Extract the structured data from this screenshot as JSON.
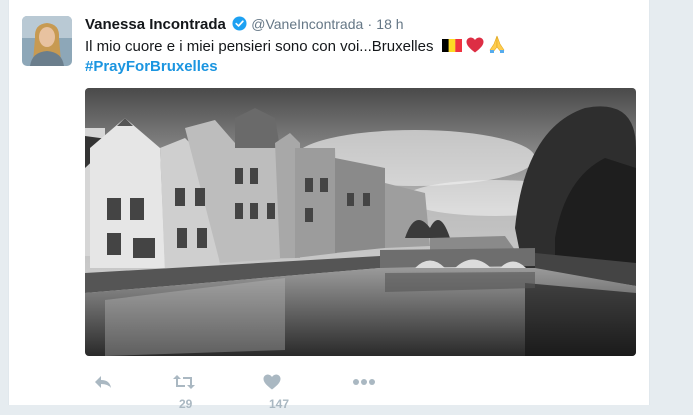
{
  "tweet": {
    "name": "Vanessa Incontrada",
    "handle": "@VaneIncontrada",
    "separator": "·",
    "time": "18 h",
    "text": "Il mio cuore e i miei pensieri sono con voi...Bruxelles",
    "hashtag": "#PrayForBruxelles",
    "emojis": [
      "flag-belgium",
      "red-heart",
      "praying-hands"
    ],
    "image_alt": "Black and white canal with bridge and historic houses",
    "retweets": "29",
    "likes": "147"
  },
  "colors": {
    "accent": "#1b95e0",
    "verified": "#1da1f2",
    "text": "#14171a",
    "muted": "#657786",
    "action": "#aab8c2",
    "heart": "#e0245e"
  }
}
